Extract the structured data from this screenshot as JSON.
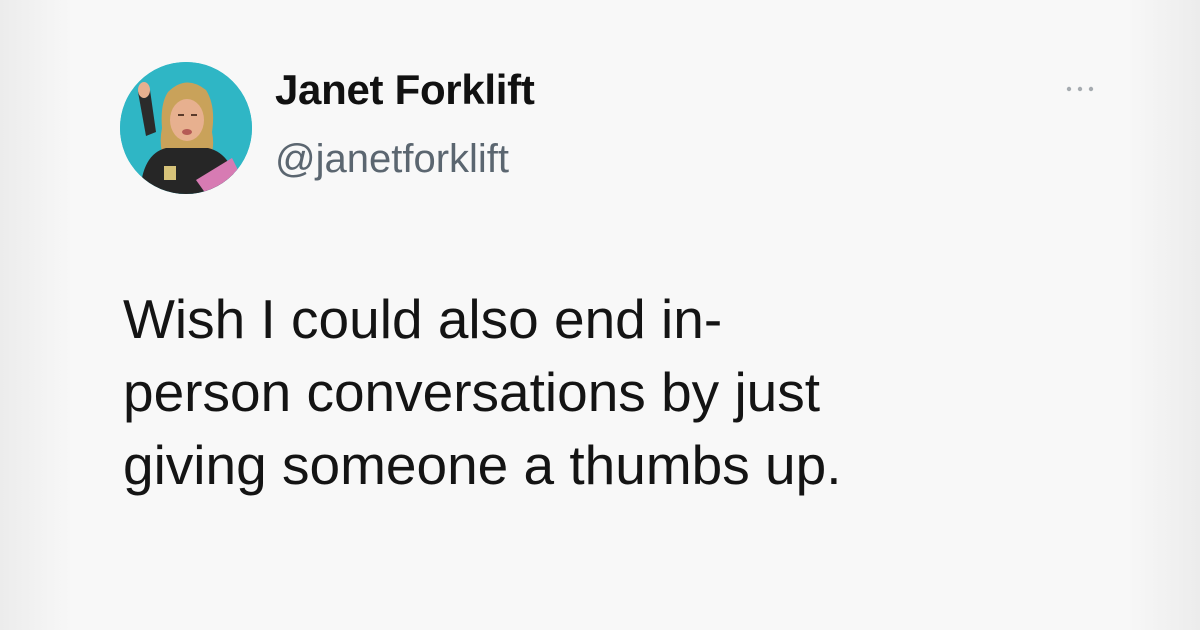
{
  "tweet": {
    "author": {
      "display_name": "Janet Forklift",
      "handle": "@janetforklift",
      "avatar": "profile-photo"
    },
    "more_icon": "more-dots-icon",
    "text_lines": [
      "Wish I could also end in-",
      "person conversations by just",
      "giving someone a thumbs up."
    ]
  },
  "colors": {
    "background": "#f8f8f8",
    "text": "#141414",
    "handle": "#5b6670",
    "avatar_bg": "#2fb6c5"
  }
}
